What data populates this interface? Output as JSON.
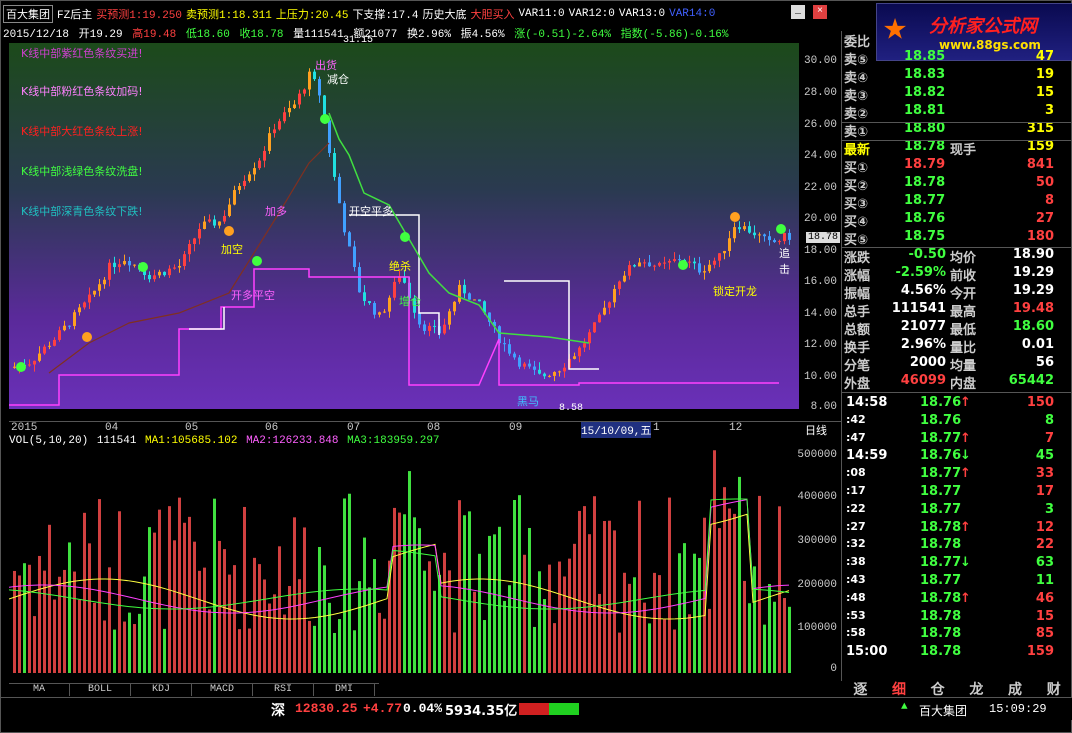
{
  "window": {
    "app_name": "百大集团",
    "formula_name": "FZ后主",
    "buy_pred_label": "买预测1:19.250",
    "sell_pred_label": "卖预测1:18.311",
    "upper_label": "上压力:20.45",
    "lower_label": "下支撑:17.4",
    "hist_label": "历史大底",
    "big_bottom_buy": "大胆买入",
    "var11": "VAR11:0",
    "var12": "VAR12:0",
    "var13": "VAR13:0",
    "var14": "VAR14:0",
    "min_btn": "_",
    "close_btn": "×"
  },
  "info": {
    "date": "2015/12/18",
    "open": "开19.29",
    "high": "高19.48",
    "low": "低18.60",
    "close": "收18.78",
    "vol": "量111541",
    "amount": "额21077",
    "turnover": "换2.96%",
    "amplitude": "振4.56%",
    "change": "涨(-0.51)-2.64%",
    "index": "指数(-5.86)-0.16%"
  },
  "logo": {
    "title": "分析家公式网",
    "url": "www.88gs.com"
  },
  "legend_texts": [
    {
      "text": "K线中部紫红色条纹买进!",
      "color": "#d040d0"
    },
    {
      "text": "K线中部粉红色条纹加码!",
      "color": "#ff80ff"
    },
    {
      "text": "K线中部大红色条纹上涨!",
      "color": "#ff2020"
    },
    {
      "text": "K线中部浅绿色条纹洗盘!",
      "color": "#40ff40"
    },
    {
      "text": "K线中部深青色条纹下跌!",
      "color": "#20c0c0"
    }
  ],
  "chart_annotations": {
    "top_value": "31.15",
    "bottom_value": "8.58",
    "current_price_tag": "18.78",
    "chu_huo": "出货",
    "jian_cang": "减仓",
    "jia_duo": "加多",
    "kai_kong_ping_duo": "开空平多",
    "kai_duo_ping_kong": "开多平空",
    "jue_sha": "绝杀",
    "zhui_ji": "追击",
    "zeng_cang": "增仓",
    "hei_ma": "黑马",
    "suo_ding_kai_long": "锁定开龙",
    "jia_kong": "加空"
  },
  "price_axis": [
    "30.00",
    "28.00",
    "26.00",
    "24.00",
    "22.00",
    "20.00",
    "18.00",
    "16.00",
    "14.00",
    "12.00",
    "10.00",
    "8.00"
  ],
  "date_axis": {
    "labels": [
      "2015",
      "04",
      "05",
      "06",
      "07",
      "08",
      "09",
      "15/10/09,五",
      "1",
      "12"
    ],
    "period": "日线"
  },
  "vol_legend": {
    "title": "VOL(5,10,20)",
    "val": "111541",
    "ma1": "MA1:105685.102",
    "ma2": "MA2:126233.848",
    "ma3": "MA3:183959.297"
  },
  "vol_axis": [
    "500000",
    "400000",
    "300000",
    "200000",
    "100000",
    "0"
  ],
  "bottom_tabs": [
    "MA",
    "BOLL",
    "KDJ",
    "MACD",
    "RSI",
    "DMI"
  ],
  "status": {
    "market": "深",
    "index_value": "12830.25",
    "index_change": "+4.77",
    "index_pct": "0.04%",
    "amount": "5934.35亿",
    "stock_tag": "百大集团",
    "time": "15:09:29"
  },
  "quote": {
    "weibi_label": "委比",
    "sells": [
      {
        "label": "卖⑤",
        "price": "18.85",
        "vol": "47"
      },
      {
        "label": "卖④",
        "price": "18.83",
        "vol": "19"
      },
      {
        "label": "卖③",
        "price": "18.82",
        "vol": "15"
      },
      {
        "label": "卖②",
        "price": "18.81",
        "vol": "3"
      },
      {
        "label": "卖①",
        "price": "18.80",
        "vol": "315"
      }
    ],
    "latest": {
      "label": "最新",
      "price": "18.78",
      "label2": "现手",
      "val": "159"
    },
    "buys": [
      {
        "label": "买①",
        "price": "18.79",
        "vol": "841"
      },
      {
        "label": "买②",
        "price": "18.78",
        "vol": "50"
      },
      {
        "label": "买③",
        "price": "18.77",
        "vol": "8"
      },
      {
        "label": "买④",
        "price": "18.76",
        "vol": "27"
      },
      {
        "label": "买⑤",
        "price": "18.75",
        "vol": "180"
      }
    ],
    "stats": [
      {
        "l1": "涨跌",
        "v1": "-0.50",
        "l2": "均价",
        "v2": "18.90",
        "c1": "#40ff40",
        "c2": "#ffffff"
      },
      {
        "l1": "涨幅",
        "v1": "-2.59%",
        "l2": "前收",
        "v2": "19.29",
        "c1": "#40ff40",
        "c2": "#ffffff"
      },
      {
        "l1": "振幅",
        "v1": "4.56%",
        "l2": "今开",
        "v2": "19.29",
        "c1": "#ffffff",
        "c2": "#ffffff"
      },
      {
        "l1": "总手",
        "v1": "111541",
        "l2": "最高",
        "v2": "19.48",
        "c1": "#ffffff",
        "c2": "#ff4040"
      },
      {
        "l1": "总额",
        "v1": "21077",
        "l2": "最低",
        "v2": "18.60",
        "c1": "#ffffff",
        "c2": "#40ff40"
      },
      {
        "l1": "换手",
        "v1": "2.96%",
        "l2": "量比",
        "v2": "0.01",
        "c1": "#ffffff",
        "c2": "#ffffff"
      },
      {
        "l1": "分笔",
        "v1": "2000",
        "l2": "均量",
        "v2": "56",
        "c1": "#ffffff",
        "c2": "#ffffff"
      },
      {
        "l1": "外盘",
        "v1": "46099",
        "l2": "内盘",
        "v2": "65442",
        "c1": "#ff4040",
        "c2": "#40ff40"
      }
    ]
  },
  "ticks": [
    {
      "time": "14:58",
      "price": "18.76",
      "dir": "up",
      "vol": "150",
      "vc": "#ff4040"
    },
    {
      "time": ":42",
      "price": "18.76",
      "dir": "",
      "vol": "8",
      "vc": "#40ff40"
    },
    {
      "time": ":47",
      "price": "18.77",
      "dir": "up",
      "vol": "7",
      "vc": "#ff4040"
    },
    {
      "time": "14:59",
      "price": "18.76",
      "dir": "down",
      "vol": "45",
      "vc": "#40ff40"
    },
    {
      "time": ":08",
      "price": "18.77",
      "dir": "up",
      "vol": "33",
      "vc": "#ff4040"
    },
    {
      "time": ":17",
      "price": "18.77",
      "dir": "",
      "vol": "17",
      "vc": "#ff4040"
    },
    {
      "time": ":22",
      "price": "18.77",
      "dir": "",
      "vol": "3",
      "vc": "#40ff40"
    },
    {
      "time": ":27",
      "price": "18.78",
      "dir": "up",
      "vol": "12",
      "vc": "#ff4040"
    },
    {
      "time": ":32",
      "price": "18.78",
      "dir": "",
      "vol": "22",
      "vc": "#ff4040"
    },
    {
      "time": ":38",
      "price": "18.77",
      "dir": "down",
      "vol": "63",
      "vc": "#40ff40"
    },
    {
      "time": ":43",
      "price": "18.77",
      "dir": "",
      "vol": "11",
      "vc": "#40ff40"
    },
    {
      "time": ":48",
      "price": "18.78",
      "dir": "up",
      "vol": "46",
      "vc": "#ff4040"
    },
    {
      "time": ":53",
      "price": "18.78",
      "dir": "",
      "vol": "15",
      "vc": "#ff4040"
    },
    {
      "time": ":58",
      "price": "18.78",
      "dir": "",
      "vol": "85",
      "vc": "#ff4040"
    },
    {
      "time": "15:00",
      "price": "18.78",
      "dir": "",
      "vol": "159",
      "vc": "#ff4040"
    }
  ],
  "right_tabs": [
    "逐",
    "细",
    "仓",
    "龙",
    "成",
    "财"
  ],
  "colors": {
    "up": "#ff4040",
    "down": "#40ff40",
    "label": "#ffff00",
    "text": "#cccccc"
  }
}
